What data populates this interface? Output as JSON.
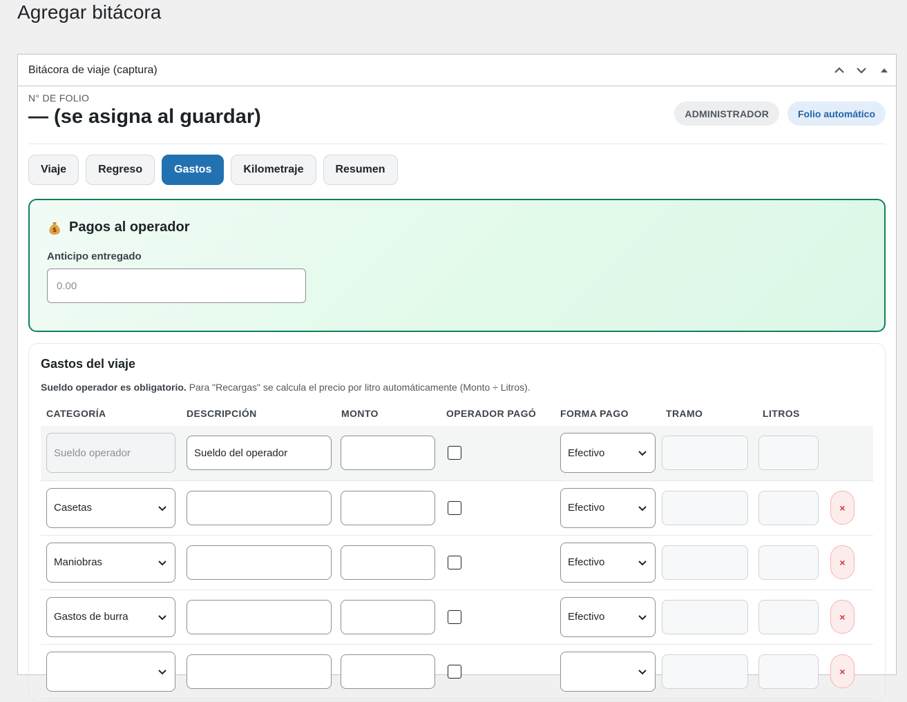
{
  "page": {
    "title": "Agregar bitácora"
  },
  "postbox": {
    "title": "Bitácora de viaje (captura)",
    "folio": {
      "label": "N° DE FOLIO",
      "value": "— (se asigna al guardar)"
    },
    "badges": {
      "role": "ADMINISTRADOR",
      "folio_mode": "Folio automático"
    }
  },
  "tabs": [
    {
      "label": "Viaje",
      "active": false
    },
    {
      "label": "Regreso",
      "active": false
    },
    {
      "label": "Gastos",
      "active": true
    },
    {
      "label": "Kilometraje",
      "active": false
    },
    {
      "label": "Resumen",
      "active": false
    }
  ],
  "pagos": {
    "icon": "money-bag-icon",
    "title": "Pagos al operador",
    "anticipo_label": "Anticipo entregado",
    "anticipo_placeholder": "0.00",
    "anticipo_value": ""
  },
  "gastos": {
    "title": "Gastos del viaje",
    "note_bold": "Sueldo operador es obligatorio.",
    "note_rest": " Para \"Recargas\" se calcula el precio por litro automáticamente (Monto ÷ Litros).",
    "columns": [
      "CATEGORÍA",
      "DESCRIPCIÓN",
      "MONTO",
      "OPERADOR PAGÓ",
      "FORMA PAGO",
      "TRAMO",
      "LITROS"
    ],
    "rows": [
      {
        "categoria": "Sueldo operador",
        "categoria_fixed": true,
        "descripcion": "Sueldo del operador",
        "monto": "",
        "operador_pago": false,
        "forma_pago": "Efectivo",
        "tramo": "",
        "litros": "",
        "removable": false
      },
      {
        "categoria": "Casetas",
        "categoria_fixed": false,
        "descripcion": "",
        "monto": "",
        "operador_pago": false,
        "forma_pago": "Efectivo",
        "tramo": "",
        "litros": "",
        "removable": true
      },
      {
        "categoria": "Maniobras",
        "categoria_fixed": false,
        "descripcion": "",
        "monto": "",
        "operador_pago": false,
        "forma_pago": "Efectivo",
        "tramo": "",
        "litros": "",
        "removable": true
      },
      {
        "categoria": "Gastos de burra",
        "categoria_fixed": false,
        "descripcion": "",
        "monto": "",
        "operador_pago": false,
        "forma_pago": "Efectivo",
        "tramo": "",
        "litros": "",
        "removable": true
      },
      {
        "categoria": "",
        "categoria_fixed": false,
        "descripcion": "",
        "monto": "",
        "operador_pago": false,
        "forma_pago": "",
        "tramo": "",
        "litros": "",
        "removable": true
      }
    ],
    "remove_symbol": "×"
  },
  "colors": {
    "accent": "#2271b1",
    "green_border": "#11805a",
    "danger": "#d63638"
  }
}
